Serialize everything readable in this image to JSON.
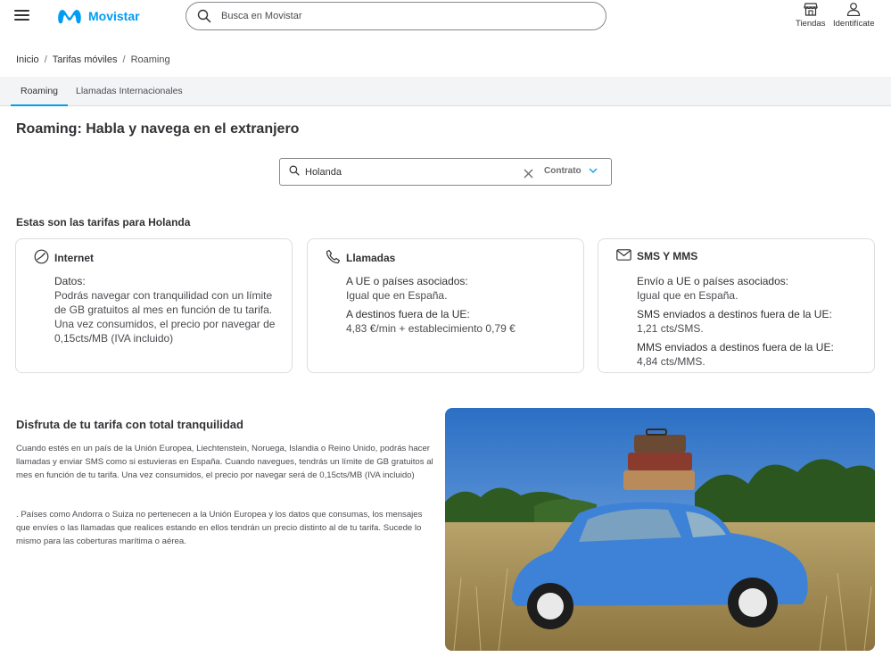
{
  "header": {
    "brand": "Movistar",
    "search_placeholder": "Busca en Movistar",
    "stores_label": "Tiendas",
    "login_label": "Identifícate"
  },
  "breadcrumb": {
    "items": [
      "Inicio",
      "Tarifas móviles",
      "Roaming"
    ]
  },
  "tabs": [
    "Roaming",
    "Llamadas Internacionales"
  ],
  "page_title": "Roaming: Habla y navega en el extranjero",
  "selector": {
    "country": "Holanda",
    "contract": "Contrato"
  },
  "rates_heading": "Estas son las tarifas para Holanda",
  "cards": {
    "internet": {
      "title": "Internet",
      "label": "Datos:",
      "text": "Podrás navegar con tranquilidad con un límite de GB gratuitos al mes en función de tu tarifa. Una vez consumidos, el precio por navegar de 0,15cts/MB (IVA incluido)"
    },
    "calls": {
      "title": "Llamadas",
      "label1": "A UE o países asociados:",
      "value1": "Igual que en España.",
      "label2": "A destinos fuera de la UE:",
      "value2": "4,83 €/min + establecimiento 0,79 €"
    },
    "sms": {
      "title": "SMS Y MMS",
      "label1": "Envío a UE o países asociados:",
      "value1": "Igual que en España.",
      "label2": "SMS enviados a destinos fuera de la UE:",
      "value2": "1,21 cts/SMS.",
      "label3": "MMS enviados a destinos fuera de la UE:",
      "value3": "4,84 cts/MMS."
    }
  },
  "promo": {
    "title": "Disfruta de tu tarifa con total tranquilidad",
    "p1": "Cuando estés en un país de la Unión Europea, Liechtenstein, Noruega, Islandia o Reino Unido, podrás hacer llamadas y enviar SMS como si estuvieras en España. Cuando navegues, tendrás un límite de GB gratuitos al mes en función de tu tarifa. Una vez consumidos, el precio por navegar será de 0,15cts/MB (IVA incluido)",
    "p2": ". Países como Andorra o Suiza no pertenecen a la Unión Europea y los datos que consumas, los mensajes que envíes o las llamadas que realices estando en ellos tendrán un precio distinto al de tu tarifa. Sucede lo mismo para las coberturas marítima o aérea."
  },
  "colors": {
    "brand": "#019df4",
    "text": "#313235",
    "tab_bg": "#f2f4f6"
  }
}
